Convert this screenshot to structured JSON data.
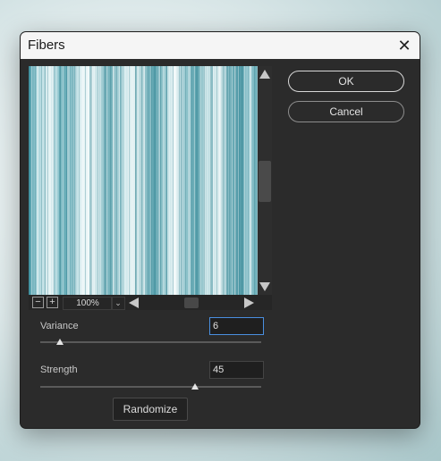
{
  "dialog": {
    "title": "Fibers",
    "close_glyph": "✕",
    "close_icon": "close-icon"
  },
  "preview": {
    "zoom_out_glyph": "−",
    "zoom_in_glyph": "+",
    "zoom_level": "100%",
    "zoom_dropdown_glyph": "⌄"
  },
  "buttons": {
    "ok": "OK",
    "cancel": "Cancel",
    "randomize": "Randomize"
  },
  "variance": {
    "label": "Variance",
    "value": "6",
    "slider_fraction": 0.09
  },
  "strength": {
    "label": "Strength",
    "value": "45",
    "slider_fraction": 0.7
  }
}
